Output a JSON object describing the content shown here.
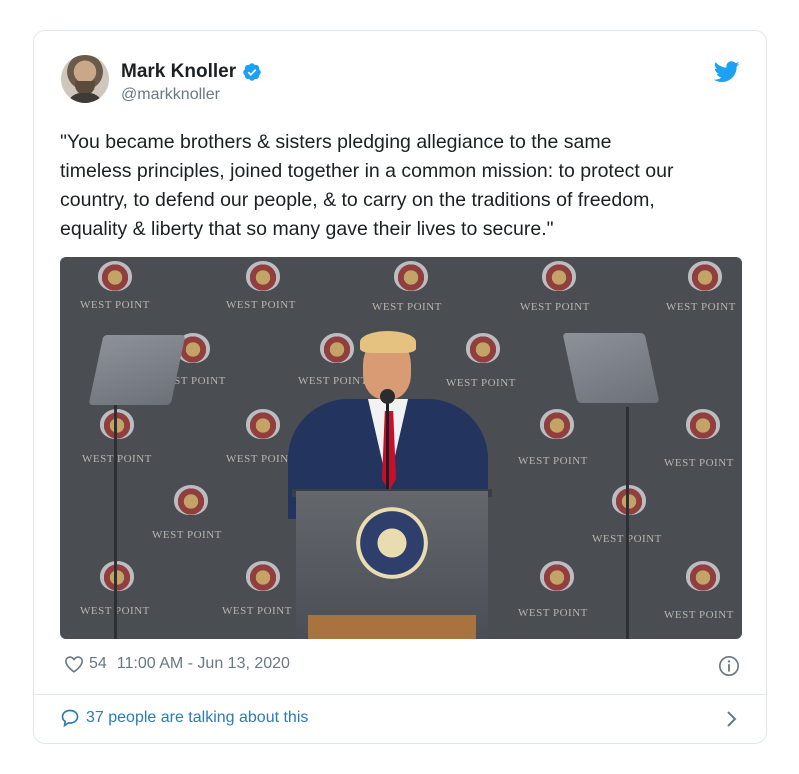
{
  "author": {
    "name": "Mark Knoller",
    "handle": "@markknoller",
    "verified": true
  },
  "tweet": {
    "text": "\"You became brothers & sisters pledging allegiance to the same\ntimeless principles, joined together in a common mission: to protect our\ncountry, to defend our people, & to carry on the traditions of freedom,\nequality &  liberty that so many gave their lives to secure.\""
  },
  "media": {
    "backdrop_label": "WEST POINT"
  },
  "meta": {
    "likes": "54",
    "timestamp": "11:00 AM - Jun 13, 2020"
  },
  "footer": {
    "talking_label": "37 people are talking about this"
  },
  "colors": {
    "twitter_blue": "#1da1f2",
    "link_blue": "#2b7bb9",
    "text": "#1c2022",
    "muted": "#697882"
  },
  "icons": [
    "verified-badge-icon",
    "twitter-bird-icon",
    "heart-icon",
    "info-icon",
    "speech-bubble-icon",
    "chevron-right-icon"
  ]
}
